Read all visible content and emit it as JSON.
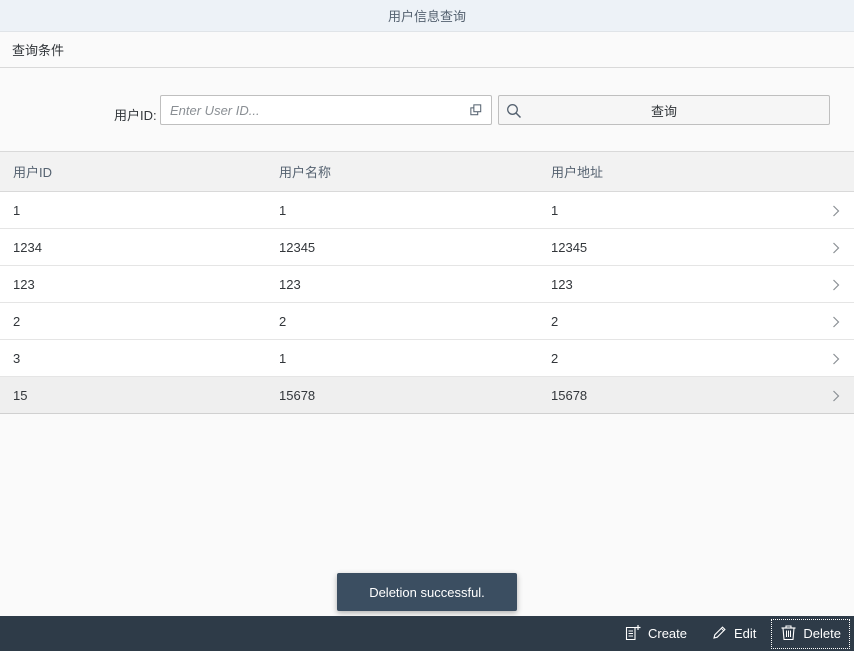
{
  "title": "用户信息查询",
  "section": {
    "title": "查询条件"
  },
  "filter": {
    "label": "用户ID:",
    "placeholder": "Enter User ID...",
    "value_help_icon": "value-help-icon",
    "search_icon": "search-icon",
    "search_label": "查询"
  },
  "table": {
    "columns": [
      "用户ID",
      "用户名称",
      "用户地址"
    ],
    "rows": [
      [
        "1",
        "1",
        "1"
      ],
      [
        "1234",
        "12345",
        "12345"
      ],
      [
        "123",
        "123",
        "123"
      ],
      [
        "2",
        "2",
        "2"
      ],
      [
        "3",
        "1",
        "2"
      ],
      [
        "15",
        "15678",
        "15678"
      ]
    ],
    "selected_row_index": 5
  },
  "toast": {
    "message": "Deletion successful."
  },
  "footer": {
    "create_label": "Create",
    "edit_label": "Edit",
    "delete_label": "Delete"
  },
  "colors": {
    "footer_bg": "#2e3b48",
    "toast_bg": "#3b4e61",
    "title_bar_bg": "#edf2f7"
  }
}
